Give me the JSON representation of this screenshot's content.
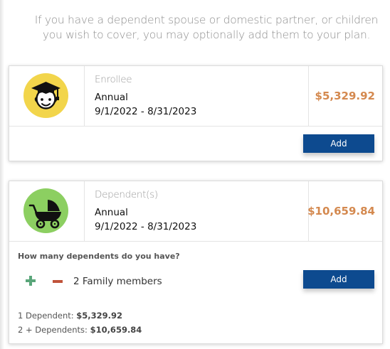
{
  "intro": {
    "line1": "If you have a dependent spouse or domestic partner, or children",
    "line2": "you wish to cover, you may optionally add them to your plan."
  },
  "enrollee_card": {
    "icon": "graduate-face-icon",
    "icon_bg": "#f2d54b",
    "role": "Enrollee",
    "term": "Annual",
    "dates": "9/1/2022 - 8/31/2023",
    "price": "$5,329.92",
    "add_label": "Add"
  },
  "dependents_card": {
    "icon": "baby-stroller-icon",
    "icon_bg": "#8ccf61",
    "role": "Dependent(s)",
    "term": "Annual",
    "dates": "9/1/2022 - 8/31/2023",
    "price": "$10,659.84",
    "question": "How many dependents do you have?",
    "count_label": "2 Family members",
    "add_label": "Add",
    "pricing": [
      {
        "label": "1 Dependent:",
        "value": "$5,329.92"
      },
      {
        "label": "2 + Dependents:",
        "value": "$10,659.84"
      }
    ]
  },
  "colors": {
    "price": "#d4894f",
    "button": "#0d4a8f",
    "plus": "#5aa67a",
    "minus": "#c0533a"
  }
}
